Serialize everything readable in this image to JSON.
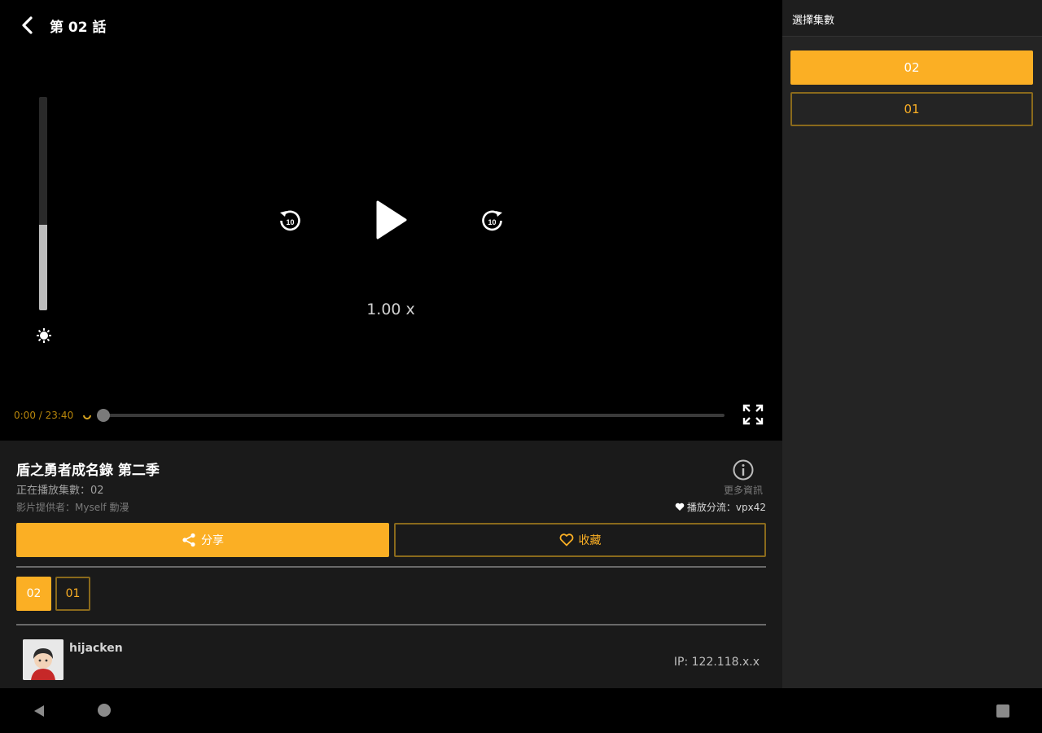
{
  "player": {
    "episode_title": "第 02 話",
    "speed_label": "1.00 x",
    "time_label": "0:00 / 23:40",
    "volume_level_fraction": 0.4,
    "progress_fraction": 0.0
  },
  "info": {
    "show_title": "盾之勇者成名錄 第二季",
    "now_playing": "正在播放集數：02",
    "provider": "影片提供者：Myself 動漫",
    "more_info_label": "更多資訊",
    "play_source": "播放分流：vpx42",
    "share_label": "分享",
    "favorite_label": "收藏",
    "episodes": [
      "02",
      "01"
    ],
    "active_episode": "02"
  },
  "comment": {
    "username": "hijacken",
    "ip": "IP: 122.118.x.x"
  },
  "side_panel": {
    "title": "選擇集數",
    "episodes": [
      "02",
      "01"
    ]
  },
  "colors": {
    "accent": "#fbaf24",
    "accent_border": "#8a6a1c",
    "panel_bg": "#1a1a1a",
    "side_bg": "#242424"
  },
  "icons": {
    "back": "chevron-left-icon",
    "brightness": "brightness-icon",
    "rewind": "rewind-10-icon",
    "play": "play-icon",
    "forward": "forward-10-icon",
    "fullscreen": "fullscreen-icon",
    "info": "info-icon",
    "share": "share-icon",
    "heart": "heart-icon"
  }
}
